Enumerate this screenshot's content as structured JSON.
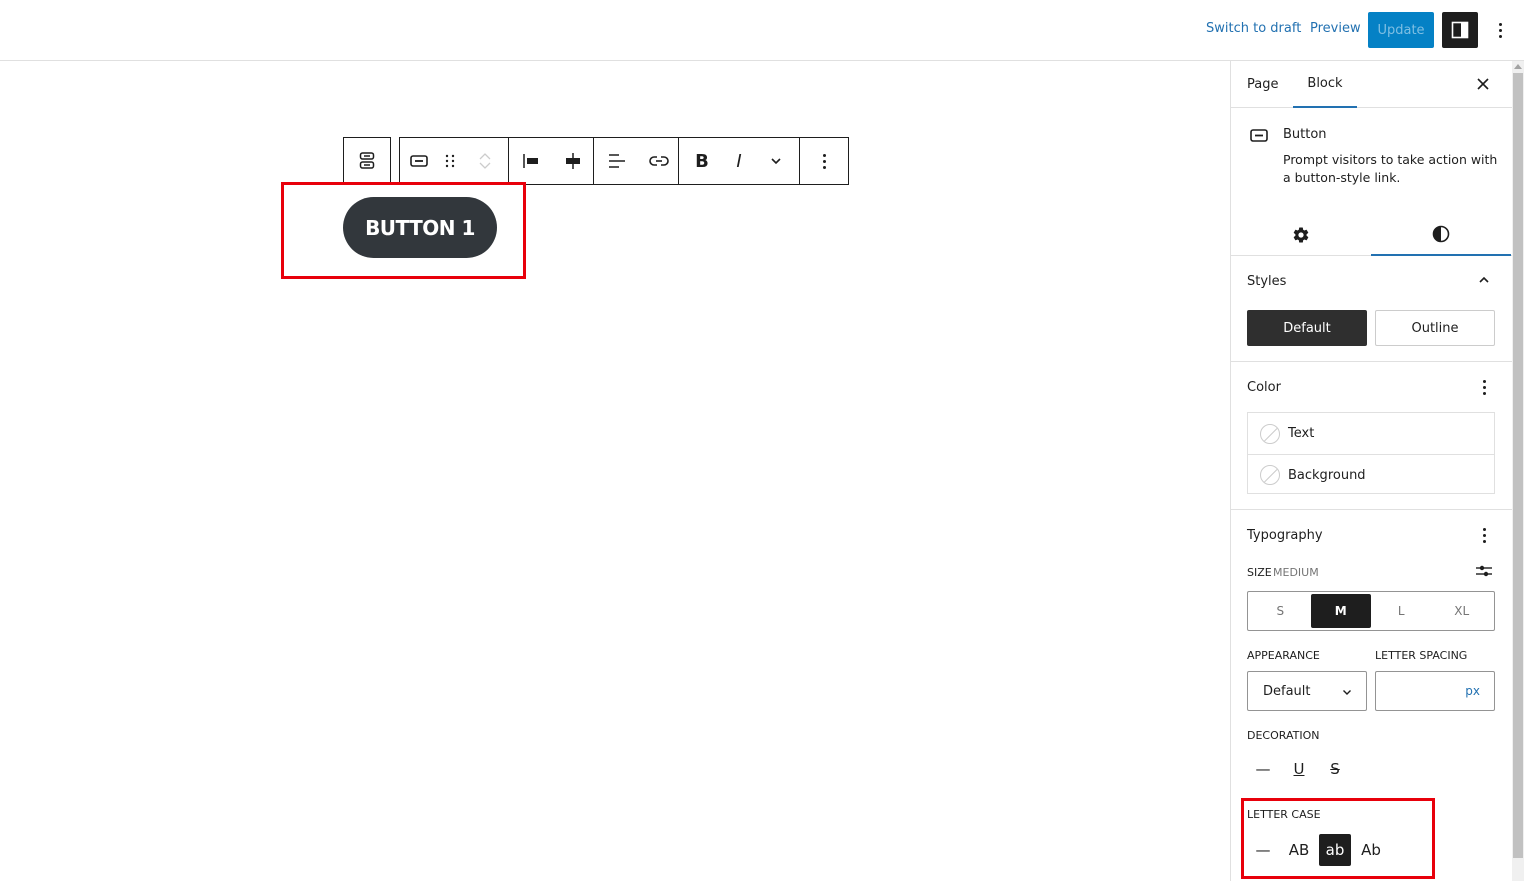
{
  "topbar": {
    "switch_to_draft": "Switch to draft",
    "preview": "Preview",
    "update": "Update"
  },
  "canvas": {
    "button_text": "BUTTON 1"
  },
  "sidebar": {
    "tabs": [
      {
        "label": "Page"
      },
      {
        "label": "Block",
        "active": true
      }
    ],
    "block": {
      "title": "Button",
      "description": "Prompt visitors to take action with a button-style link."
    },
    "styles": {
      "title": "Styles",
      "options": [
        {
          "label": "Default",
          "active": true
        },
        {
          "label": "Outline"
        }
      ]
    },
    "color": {
      "title": "Color",
      "items": [
        {
          "label": "Text"
        },
        {
          "label": "Background"
        }
      ]
    },
    "typography": {
      "title": "Typography",
      "size_label": "SIZE",
      "size_value": "MEDIUM",
      "sizes": [
        {
          "label": "S"
        },
        {
          "label": "M",
          "active": true
        },
        {
          "label": "L"
        },
        {
          "label": "XL"
        }
      ],
      "appearance_label": "APPEARANCE",
      "appearance_value": "Default",
      "letter_spacing_label": "LETTER SPACING",
      "letter_spacing_value": "",
      "letter_spacing_unit": "px",
      "decoration_label": "DECORATION",
      "decoration_options": [
        {
          "label": "None",
          "glyph": "—"
        },
        {
          "label": "Underline",
          "glyph": "U"
        },
        {
          "label": "Strikethrough",
          "glyph": "S"
        }
      ],
      "letter_case_label": "LETTER CASE",
      "letter_case_options": [
        {
          "label": "None",
          "glyph": "—"
        },
        {
          "label": "Uppercase",
          "glyph": "AB"
        },
        {
          "label": "Lowercase",
          "glyph": "ab",
          "active": true
        },
        {
          "label": "Capitalize",
          "glyph": "Ab"
        }
      ]
    }
  },
  "colors": {
    "accent": "#2271b1",
    "update_bg": "#0581c5",
    "dark": "#1e1e1e",
    "highlight": "#e8000b",
    "button_bg": "#32373c"
  }
}
